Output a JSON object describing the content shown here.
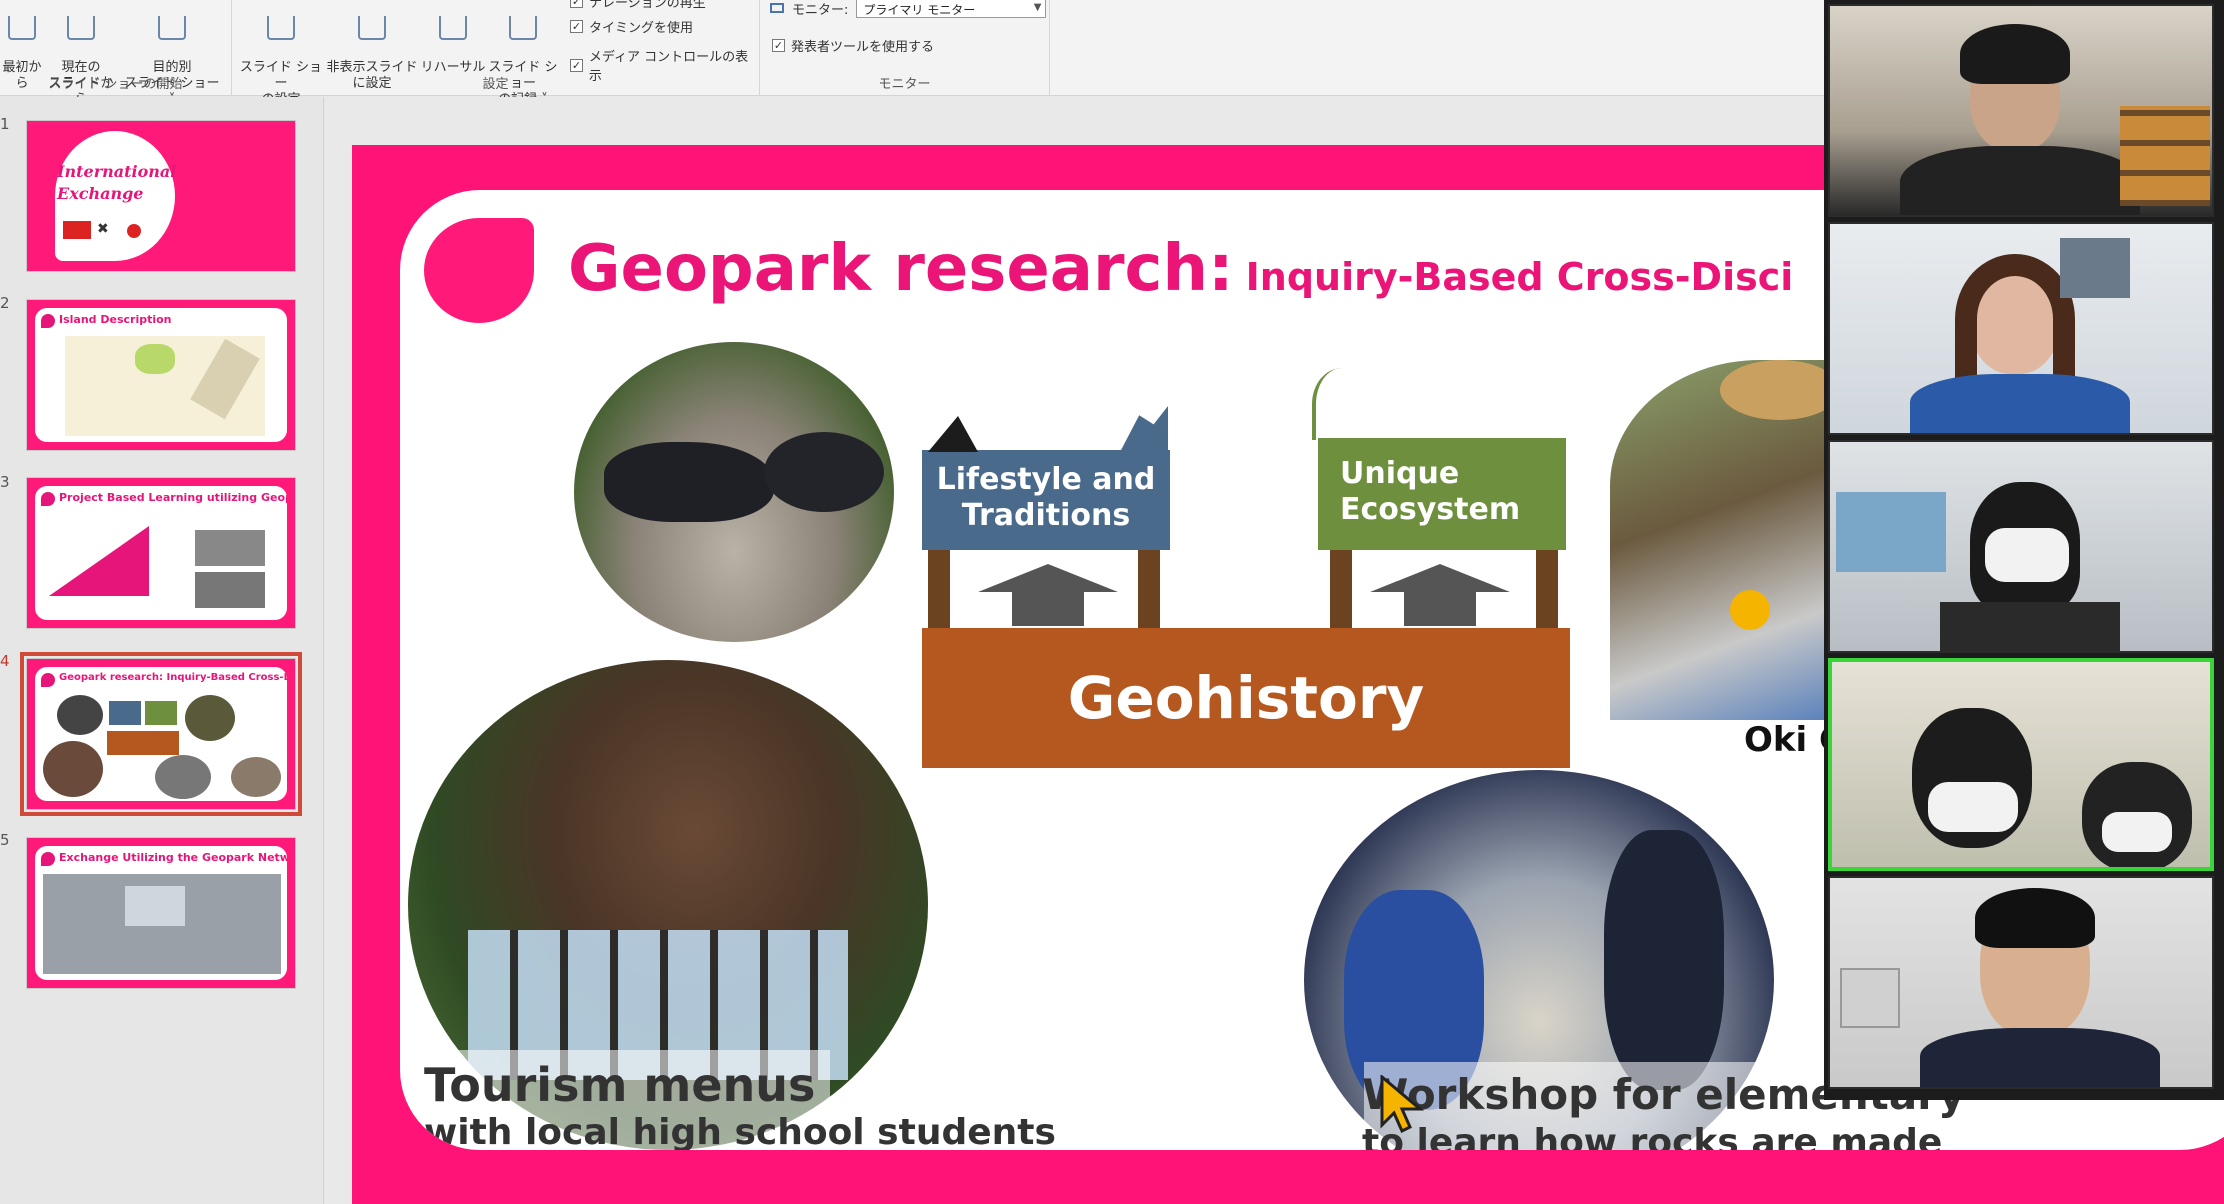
{
  "ribbon": {
    "slideshow_group_label": "スライド ショーの開始",
    "setup_group_label": "設定",
    "monitor_group_label": "モニター",
    "buttons": {
      "from_beginning": "最初から",
      "from_current": "現在の\nスライドから",
      "custom_show": "目的別\nスライド ショー ˅",
      "setup_show": "スライド ショー\nの設定",
      "hide_slide": "非表示スライド\nに設定",
      "rehearse": "リハーサル",
      "record": "スライド ショー\nの記録 ˅"
    },
    "checks": {
      "narration": "ナレーションの再生",
      "timings": "タイミングを使用",
      "media_controls": "メディア コントロールの表示",
      "presenter_view": "発表者ツールを使用する"
    },
    "monitor_label": "モニター:",
    "monitor_value": "プライマリ モニター"
  },
  "thumbnails": [
    {
      "num": "1",
      "title": "International Exchange"
    },
    {
      "num": "2",
      "title": "Island Description"
    },
    {
      "num": "3",
      "title": "Project Based Learning utilizing Geopark"
    },
    {
      "num": "4",
      "title": "Geopark research: Inquiry-Based Cross-Disciplinary Study"
    },
    {
      "num": "5",
      "title": "Exchange Utilizing the Geopark Network"
    }
  ],
  "slide": {
    "title_main": "Geopark research:",
    "title_sub": "Inquiry-Based Cross-Disci",
    "sign_left": "Lifestyle and\nTraditions",
    "sign_right": "Unique\nEcosystem",
    "base": "Geohistory",
    "caption_tourism_1": "Tourism menus",
    "caption_tourism_2": "with local high school students",
    "caption_workshop_1": "Workshop for elementary",
    "caption_workshop_2": "to learn how rocks are made",
    "caption_oki": "Oki Gneis"
  },
  "colors": {
    "accent_pink": "#ff1377",
    "title_pink": "#ea1577",
    "sign_blue": "#4a6a8c",
    "sign_green": "#6e8f3e",
    "geohistory_brown": "#b5581f",
    "active_speaker": "#3ad33a"
  },
  "icons": {
    "cursor": "mouse-pointer-icon"
  }
}
